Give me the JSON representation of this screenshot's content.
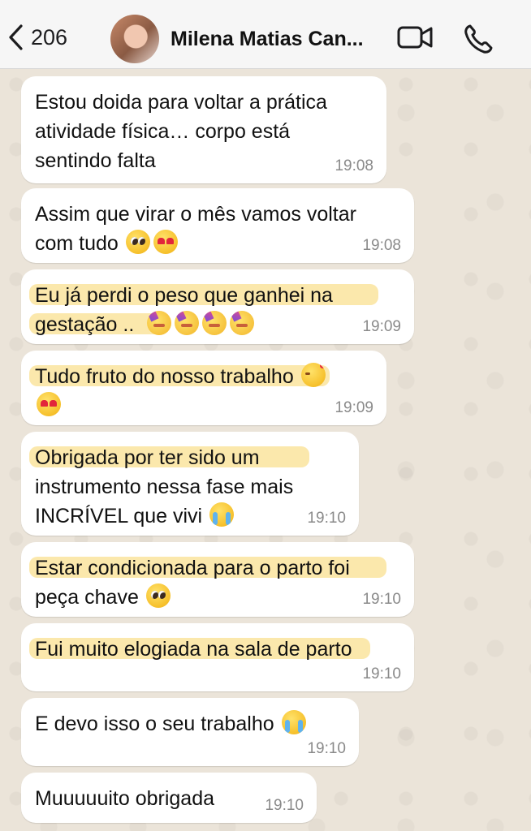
{
  "header": {
    "back_count": "206",
    "contact_name": "Milena Matias Can..."
  },
  "colors": {
    "bubble": "#ffffff",
    "highlight": "#fbe6a3",
    "header_bg": "#f6f6f6",
    "chat_bg": "#ebe4d9"
  },
  "messages": [
    {
      "lines": [
        "Estou doida para voltar a prática",
        "atividade física… corpo está",
        "sentindo falta"
      ],
      "emojis": [],
      "time": "19:08",
      "highlighted": false
    },
    {
      "lines": [
        "Assim que virar o mês vamos voltar",
        "com tudo"
      ],
      "emojis": [
        "pleading-face",
        "heart-eyes-face"
      ],
      "time": "19:08",
      "highlighted": false
    },
    {
      "lines": [
        "Eu já perdi o peso que ganhei na",
        "gestação .."
      ],
      "emojis": [
        "partying-face",
        "partying-face",
        "partying-face",
        "partying-face"
      ],
      "time": "19:09",
      "highlighted": true
    },
    {
      "lines": [
        "Tudo fruto do nosso trabalho"
      ],
      "emojis": [
        "smiling-face-with-hearts",
        "heart-eyes-face"
      ],
      "time": "19:09",
      "highlighted": true
    },
    {
      "lines": [
        "Obrigada por ter sido um",
        "instrumento nessa fase mais",
        "INCRÍVEL que vivi"
      ],
      "emojis": [
        "crying-face"
      ],
      "time": "19:10",
      "highlighted": true
    },
    {
      "lines": [
        "Estar condicionada para o parto foi",
        "peça chave"
      ],
      "emojis": [
        "pleading-face"
      ],
      "time": "19:10",
      "highlighted": true
    },
    {
      "lines": [
        "Fui muito elogiada na sala de parto"
      ],
      "emojis": [],
      "time": "19:10",
      "highlighted": true
    },
    {
      "lines": [
        "E devo isso o seu trabalho"
      ],
      "emojis": [
        "crying-face"
      ],
      "time": "19:10",
      "highlighted": false
    },
    {
      "lines": [
        "Muuuuuito obrigada"
      ],
      "emojis": [],
      "time": "19:10",
      "highlighted": false
    }
  ]
}
